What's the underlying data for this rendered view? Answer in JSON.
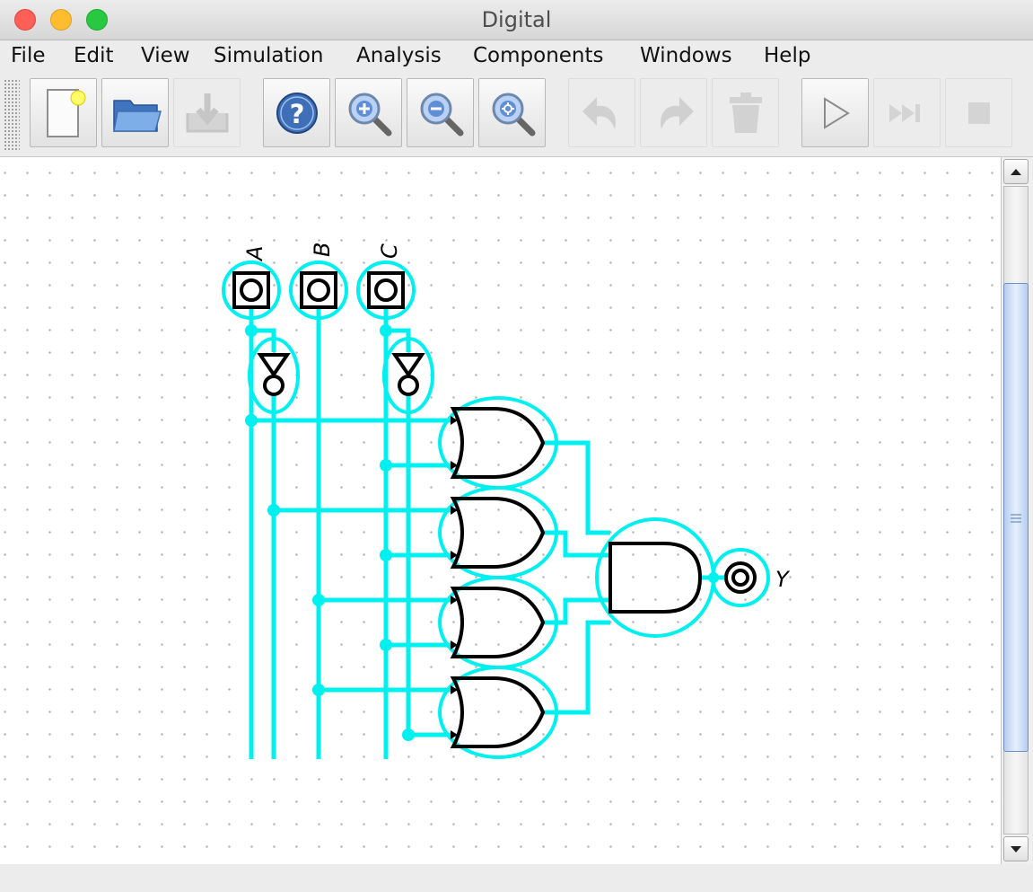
{
  "window": {
    "title": "Digital"
  },
  "menu": [
    "File",
    "Edit",
    "View",
    "Simulation",
    "Analysis",
    "Components",
    "Windows",
    "Help"
  ],
  "toolbar": {
    "buttons": [
      {
        "name": "new",
        "icon": "new-file-icon",
        "enabled": true
      },
      {
        "name": "open",
        "icon": "open-folder-icon",
        "enabled": true
      },
      {
        "name": "save",
        "icon": "save-icon",
        "enabled": false
      },
      {
        "name": "help",
        "icon": "help-icon",
        "enabled": true
      },
      {
        "name": "zoom-in",
        "icon": "zoom-in-icon",
        "enabled": true
      },
      {
        "name": "zoom-out",
        "icon": "zoom-out-icon",
        "enabled": true
      },
      {
        "name": "zoom-fit",
        "icon": "zoom-fit-icon",
        "enabled": true
      },
      {
        "name": "undo",
        "icon": "undo-icon",
        "enabled": false
      },
      {
        "name": "redo",
        "icon": "redo-icon",
        "enabled": false
      },
      {
        "name": "delete",
        "icon": "trash-icon",
        "enabled": false
      },
      {
        "name": "start-simulation",
        "icon": "play-icon",
        "enabled": true
      },
      {
        "name": "step",
        "icon": "fast-forward-icon",
        "enabled": false
      },
      {
        "name": "stop-simulation",
        "icon": "stop-icon",
        "enabled": false
      }
    ]
  },
  "circuit": {
    "inputs": [
      "A",
      "B",
      "C"
    ],
    "output": "Y",
    "highlight_color": "#00f0f0",
    "gates": [
      "not",
      "not",
      "or",
      "or",
      "or",
      "or",
      "and"
    ]
  }
}
